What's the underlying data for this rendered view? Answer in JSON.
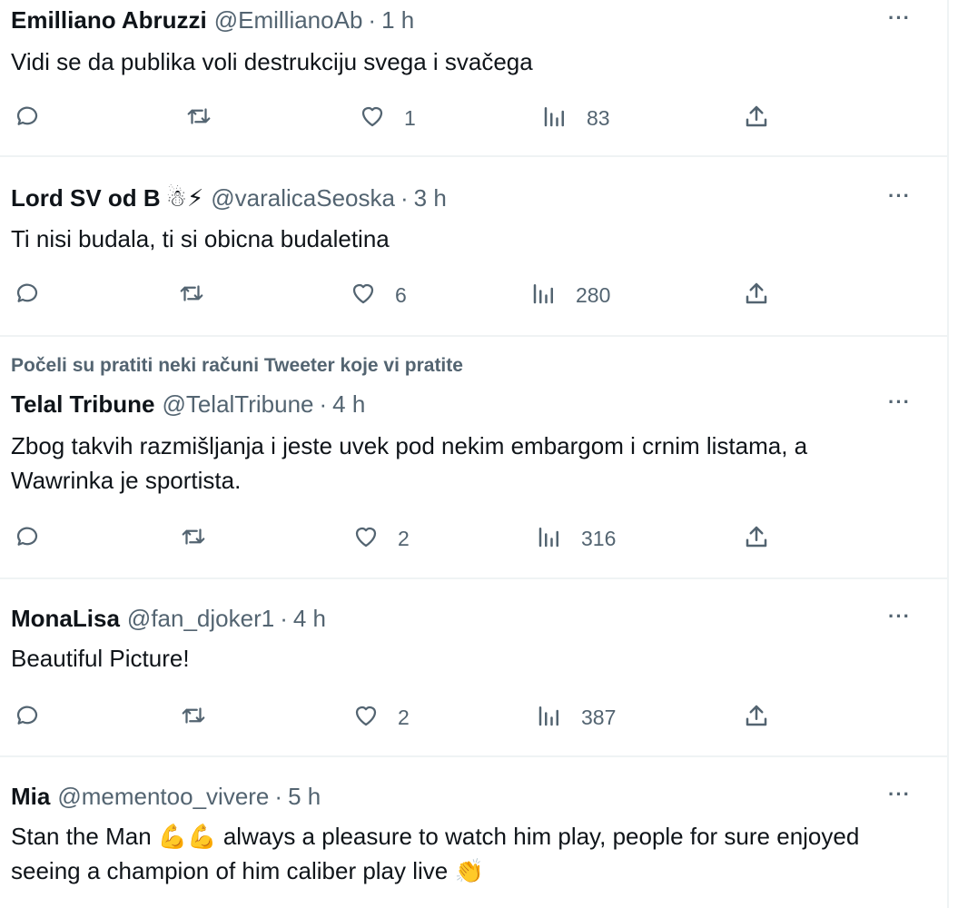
{
  "social_context": "Počeli su pratiti neki računi Tweeter koje vi pratite",
  "more_label": "···",
  "tweets": [
    {
      "name": "Emilliano Abruzzi",
      "handle": "@EmillianoAb",
      "sep": "·",
      "time": "1 h",
      "name_emoji": "",
      "text": "Vidi se da publika voli destrukciju svega i svačega",
      "replies": "",
      "retweets": "",
      "likes": "1",
      "views": "83"
    },
    {
      "name": "Lord SV od B",
      "name_emoji": "☃⚡",
      "handle": "@varalicaSeoska",
      "sep": "·",
      "time": "3 h",
      "text": "Ti nisi budala, ti si obicna budaletina",
      "replies": "",
      "retweets": "",
      "likes": "6",
      "views": "280"
    },
    {
      "name": "Telal Tribune",
      "handle": "@TelalTribune",
      "sep": "·",
      "time": "4 h",
      "name_emoji": "",
      "text": "Zbog takvih razmišljanja i jeste uvek pod nekim embargom i crnim listama, a Wawrinka je sportista.",
      "replies": "",
      "retweets": "",
      "likes": "2",
      "views": "316"
    },
    {
      "name": "MonaLisa",
      "handle": "@fan_djoker1",
      "sep": "·",
      "time": "4 h",
      "name_emoji": "",
      "text": "Beautiful Picture!",
      "replies": "",
      "retweets": "",
      "likes": "2",
      "views": "387"
    },
    {
      "name": "Mia",
      "handle": "@mementoo_vivere",
      "sep": "·",
      "time": "5 h",
      "name_emoji": "",
      "text": "Stan the Man 💪💪 always a pleasure to watch him play, people for sure enjoyed seeing a champion of him caliber play live 👏"
    }
  ],
  "icons": [
    "reply-icon",
    "retweet-icon",
    "like-icon",
    "views-icon",
    "share-icon",
    "more-icon"
  ],
  "colors": {
    "text": "#0f1419",
    "secondary": "#536471",
    "divider": "#eff3f4"
  }
}
